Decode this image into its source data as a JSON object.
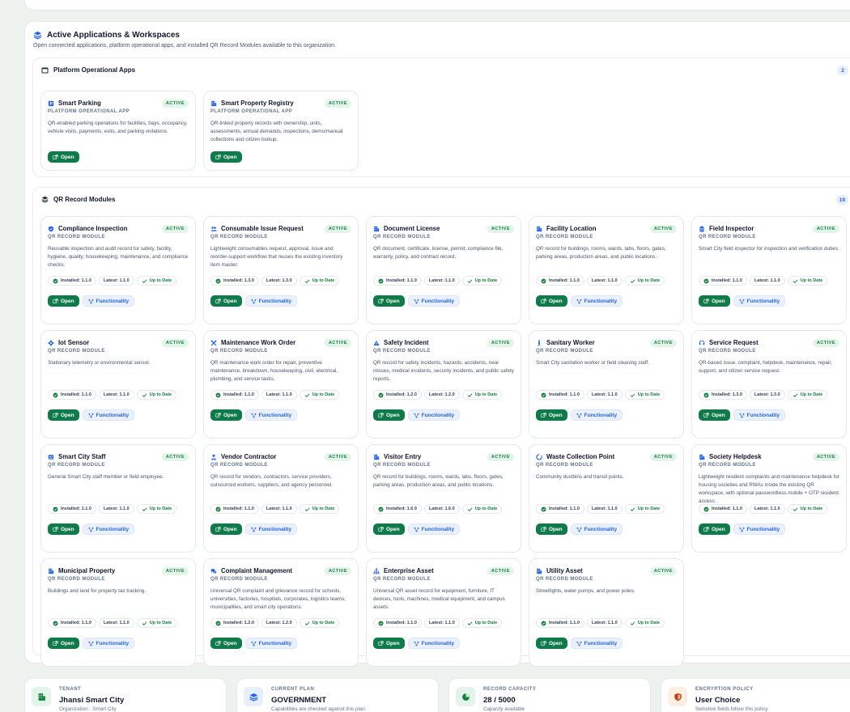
{
  "section": {
    "title": "Active Applications & Workspaces",
    "subtitle": "Open connected applications, platform operational apps, and installed QR Record Modules available to this organization."
  },
  "platform_apps": {
    "title": "Platform Operational Apps",
    "count": "2",
    "items": [
      {
        "title": "Smart Parking",
        "subtitle": "PLATFORM OPERATIONAL APP",
        "badge": "ACTIVE",
        "icon": "parking-icon",
        "desc": "QR-enabled parking operations for facilities, bays, occupancy, vehicle visits, payments, exits, and parking violations.",
        "open": "Open"
      },
      {
        "title": "Smart Property Registry",
        "subtitle": "PLATFORM OPERATIONAL APP",
        "badge": "ACTIVE",
        "icon": "building-icon",
        "desc": "QR-linked property records with ownership, units, assessments, annual demands, inspections, demo/manual collections and citizen lookup.",
        "open": "Open"
      }
    ]
  },
  "qr_modules": {
    "title": "QR Record Modules",
    "count": "19",
    "sub": "QR RECORD MODULE",
    "badge": "ACTIVE",
    "open": "Open",
    "functionality": "Functionality",
    "latest_prefix": "Latest: ",
    "installed_prefix": "Installed: ",
    "up_to_date": "Up to Date",
    "items": [
      {
        "title": "Compliance Inspection",
        "icon": "shield-check-icon",
        "desc": "Reusable inspection and audit record for safety, facility, hygiene, quality, housekeeping, maintenance, and compliance checks.",
        "installed": "1.1.0",
        "latest": "1.1.0"
      },
      {
        "title": "Consumable Issue Request",
        "icon": "users-icon",
        "desc": "Lightweight consumables request, approval, issue and reorder-support workflow that reuses the existing inventory item master.",
        "installed": "1.3.0",
        "latest": "1.3.0"
      },
      {
        "title": "Document License",
        "icon": "building-icon",
        "desc": "QR document, certificate, license, permit, compliance file, warranty, policy, and contract record.",
        "installed": "1.1.0",
        "latest": "1.1.0"
      },
      {
        "title": "Facility Location",
        "icon": "building-icon",
        "desc": "QR record for buildings, rooms, wards, labs, floors, gates, parking areas, production areas, and public locations.",
        "installed": "1.1.0",
        "latest": "1.1.0"
      },
      {
        "title": "Field Inspector",
        "icon": "clipboard-icon",
        "desc": "Smart City field inspector for inspection and verification duties.",
        "installed": "1.1.0",
        "latest": "1.1.0"
      },
      {
        "title": "Iot Sensor",
        "icon": "gear-icon",
        "desc": "Stationary telemetry or environmental sensor.",
        "installed": "1.1.0",
        "latest": "1.1.0"
      },
      {
        "title": "Maintenance Work Order",
        "icon": "wrench-icon",
        "desc": "QR maintenance work order for repair, preventive maintenance, breakdown, housekeeping, civil, electrical, plumbing, and service tasks.",
        "installed": "1.1.0",
        "latest": "1.1.0"
      },
      {
        "title": "Safety Incident",
        "icon": "warning-icon",
        "desc": "QR record for safety incidents, hazards, accidents, near misses, medical incidents, security incidents, and public safety reports.",
        "installed": "1.2.0",
        "latest": "1.2.0"
      },
      {
        "title": "Sanitary Worker",
        "icon": "person-icon",
        "desc": "Smart City sanitation worker or field cleaning staff.",
        "installed": "1.1.0",
        "latest": "1.1.0"
      },
      {
        "title": "Service Request",
        "icon": "headset-icon",
        "desc": "QR-based issue, complaint, helpdesk, maintenance, repair, support, and citizen service request.",
        "installed": "1.3.0",
        "latest": "1.3.0"
      },
      {
        "title": "Smart City Staff",
        "icon": "id-card-icon",
        "desc": "General Smart City staff member or field employee.",
        "installed": "1.1.0",
        "latest": "1.1.0"
      },
      {
        "title": "Vendor Contractor",
        "icon": "user-tie-icon",
        "desc": "QR record for vendors, contractors, service providers, outsourced workers, suppliers, and agency personnel.",
        "installed": "1.1.0",
        "latest": "1.1.0"
      },
      {
        "title": "Visitor Entry",
        "icon": "building-icon",
        "desc": "QR record for buildings, rooms, wards, labs, floors, gates, parking areas, production areas, and public locations.",
        "installed": "1.6.0",
        "latest": "1.6.0"
      },
      {
        "title": "Waste Collection Point",
        "icon": "recycle-icon",
        "desc": "Community dustbins and transit points.",
        "installed": "1.1.0",
        "latest": "1.1.0"
      },
      {
        "title": "Society Helpdesk",
        "icon": "building-icon",
        "desc": "Lightweight resident complaints and maintenance helpdesk for housing societies and RWAs inside the existing QR workspace, with optional passwordless mobile + OTP resident access.",
        "installed": "1.1.0",
        "latest": "1.1.0"
      },
      {
        "title": "Municipal Property",
        "icon": "building-icon",
        "desc": "Buildings and land for property tax tracking.",
        "installed": "1.1.0",
        "latest": "1.1.0"
      },
      {
        "title": "Complaint Management",
        "icon": "chat-icon",
        "desc": "Universal QR complaint and grievance record for schools, universities, factories, hospitals, corporates, logistics teams, municipalities, and smart city operations.",
        "installed": "1.2.0",
        "latest": "1.2.0"
      },
      {
        "title": "Enterprise Asset",
        "icon": "sitemap-icon",
        "desc": "Universal QR asset record for equipment, furniture, IT devices, tools, machines, medical equipment, and campus assets.",
        "installed": "1.1.0",
        "latest": "1.1.0"
      },
      {
        "title": "Utility Asset",
        "icon": "building-icon",
        "desc": "Streetlights, water pumps, and power poles.",
        "installed": "1.1.0",
        "latest": "1.1.0"
      }
    ]
  },
  "stats": [
    {
      "label": "TENANT",
      "value": "Jhansi Smart City",
      "note": "Organization · Smart City",
      "icon": "building-icon",
      "color": "#15803d",
      "bg": "#e3f5ea"
    },
    {
      "label": "CURRENT PLAN",
      "value": "GOVERNMENT",
      "note": "Capabilities are checked against this plan.",
      "icon": "layers-icon",
      "color": "#2563eb",
      "bg": "#e8effc"
    },
    {
      "label": "RECORD CAPACITY",
      "value": "28 / 5000",
      "note": "Capacity available",
      "icon": "pie-icon",
      "color": "#15803d",
      "bg": "#e3f5ea"
    },
    {
      "label": "ENCRYPTION POLICY",
      "value": "User Choice",
      "note": "Sensitive fields follow this policy.",
      "icon": "shield-icon",
      "color": "#c2410c",
      "bg": "#fdf0e3"
    }
  ]
}
